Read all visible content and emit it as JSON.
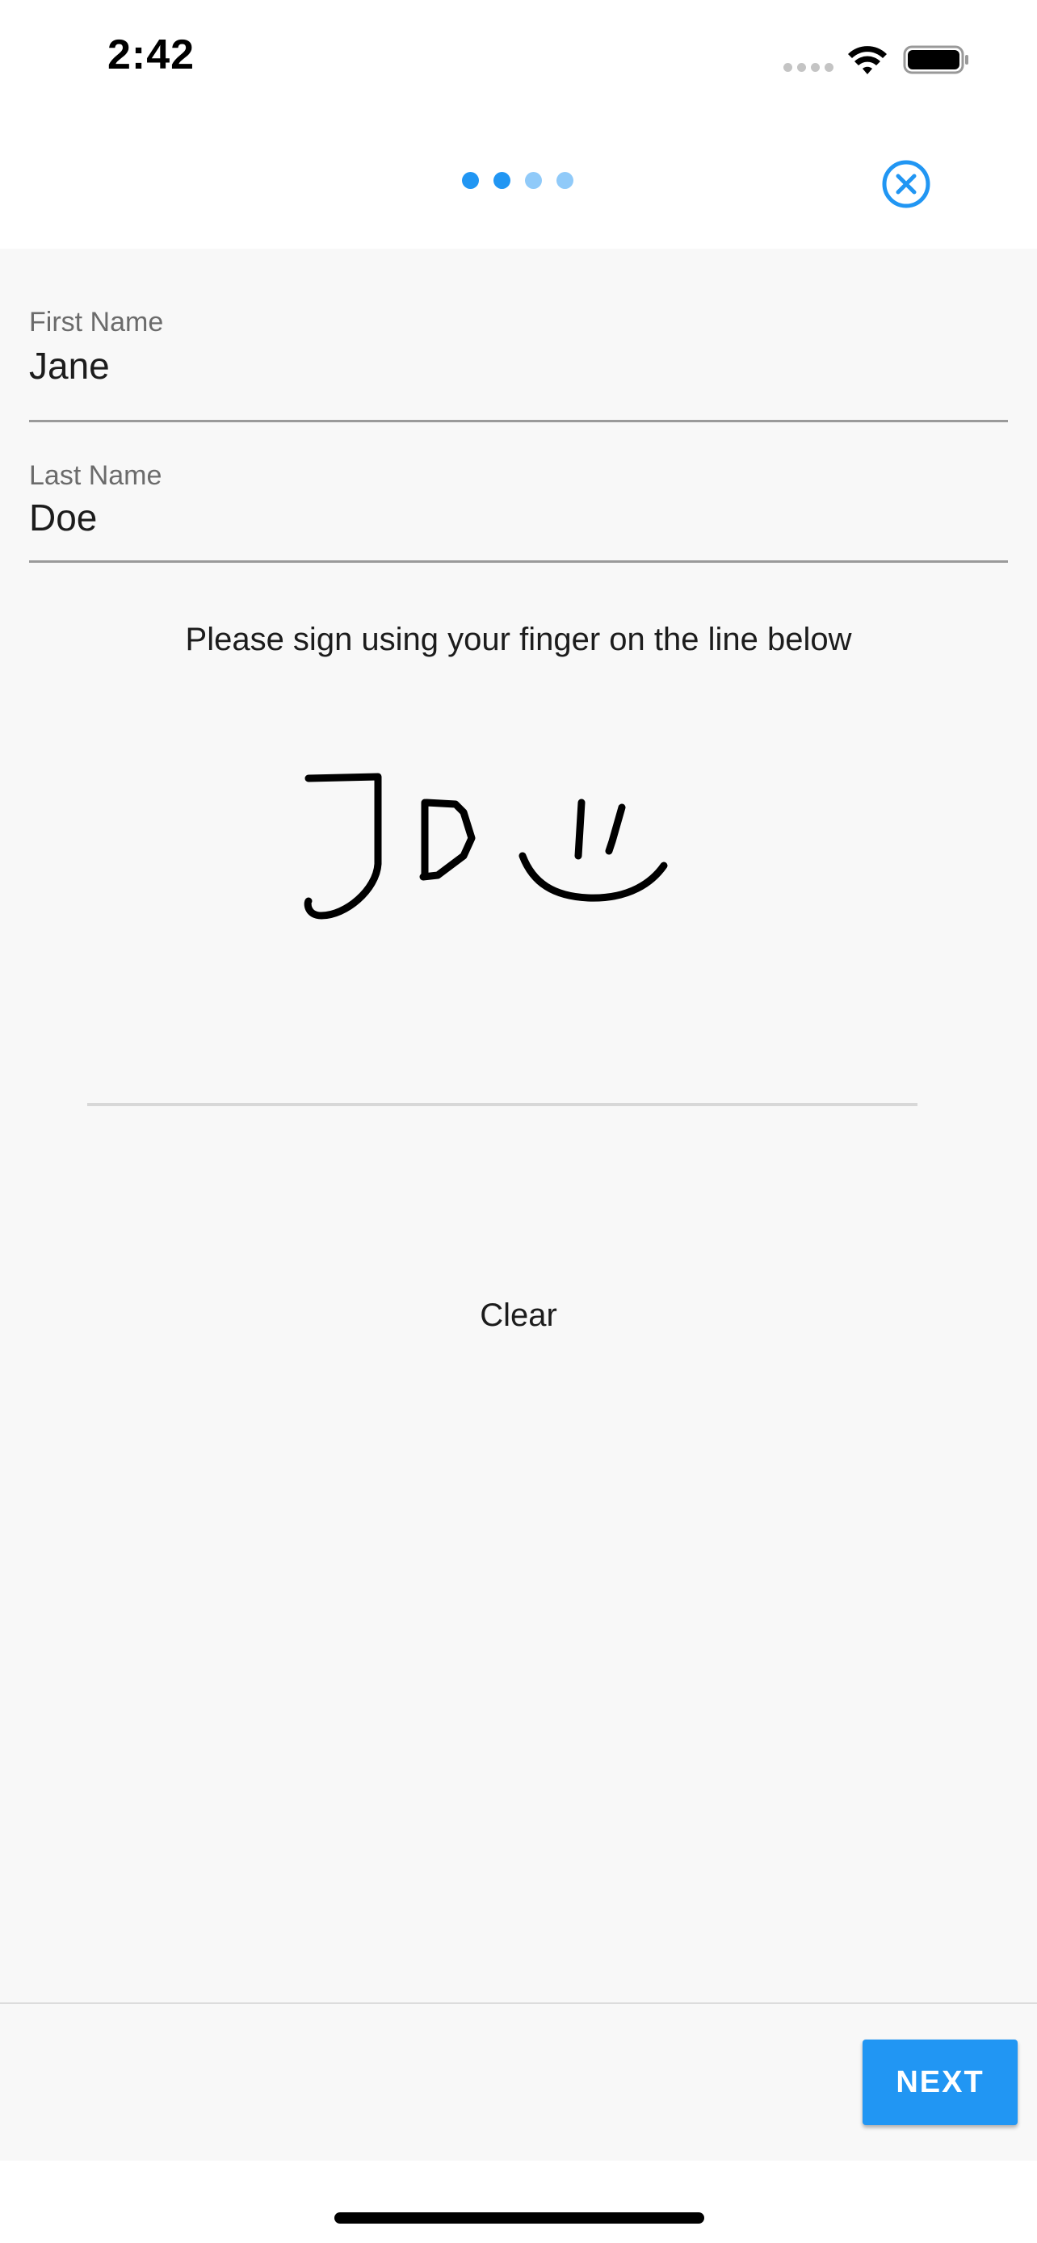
{
  "status_bar": {
    "time": "2:42"
  },
  "stepper": {
    "total_steps": 4,
    "active_steps": 2,
    "active_color": "#2196f3",
    "inactive_color": "#90caf9"
  },
  "close_icon": "close-circle-icon",
  "form": {
    "first_name": {
      "label": "First Name",
      "value": "Jane"
    },
    "last_name": {
      "label": "Last Name",
      "value": "Doe"
    }
  },
  "signature": {
    "instructions": "Please sign using your finger on the line below",
    "clear_label": "Clear"
  },
  "footer": {
    "next_label": "NEXT",
    "accent_color": "#2196f3"
  }
}
